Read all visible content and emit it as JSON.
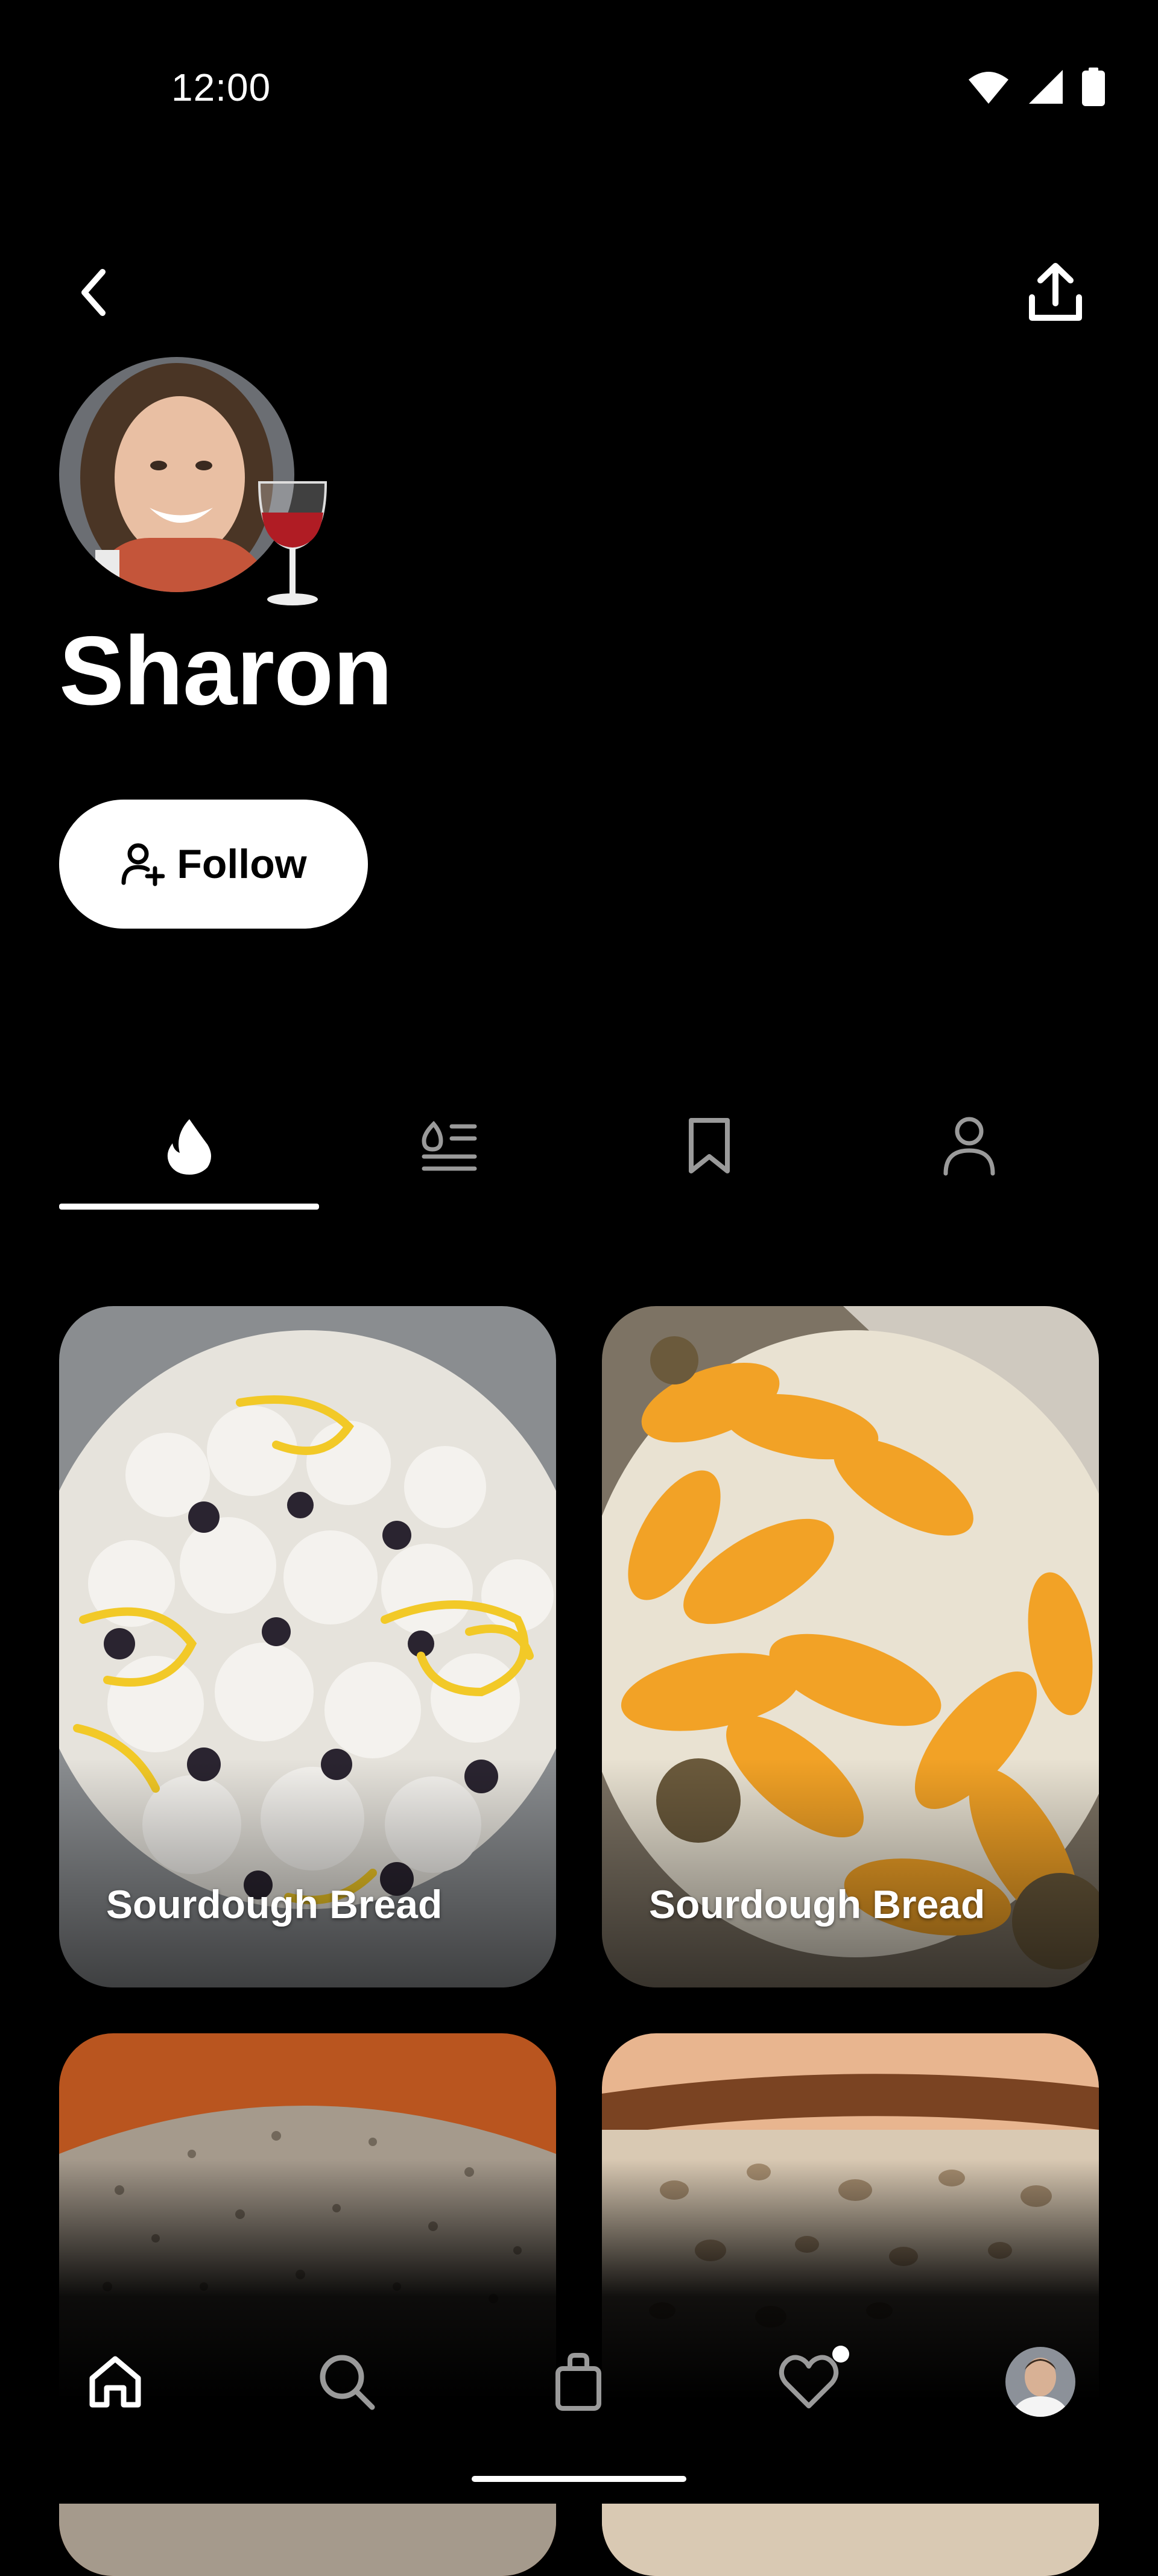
{
  "status_bar": {
    "time": "12:00",
    "icons": [
      "wifi-icon",
      "signal-icon",
      "battery-icon"
    ]
  },
  "header": {
    "back_icon": "chevron-left-icon",
    "share_icon": "share-upload-icon"
  },
  "profile": {
    "name": "Sharon",
    "badge_icon": "wine-glass-icon",
    "follow_label": "Follow",
    "follow_icon": "add-person-icon"
  },
  "tabs": [
    {
      "icon": "flame-icon",
      "selected": true
    },
    {
      "icon": "recipes-list-icon",
      "selected": false
    },
    {
      "icon": "bookmark-icon",
      "selected": false
    },
    {
      "icon": "person-icon",
      "selected": false
    }
  ],
  "cards": [
    {
      "title": "Sourdough Bread"
    },
    {
      "title": "Sourdough Bread"
    },
    {
      "title": ""
    },
    {
      "title": ""
    }
  ],
  "bottom_nav": [
    {
      "icon": "home-icon",
      "selected": true
    },
    {
      "icon": "search-icon",
      "selected": false
    },
    {
      "icon": "shopping-bag-icon",
      "selected": false
    },
    {
      "icon": "heart-icon",
      "selected": false,
      "badge": true
    },
    {
      "icon": "profile-avatar",
      "selected": false
    }
  ],
  "colors": {
    "background": "#000000",
    "foreground": "#ffffff",
    "inactive_icon": "#9a9a9a"
  }
}
